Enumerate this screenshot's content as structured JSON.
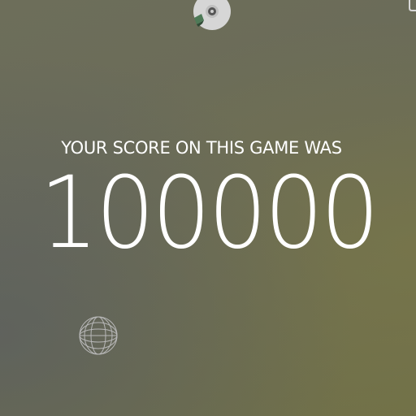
{
  "game": {
    "score_label": "YOUR SCORE ON THIS GAME WAS",
    "score_value": "100000"
  },
  "icons": {
    "top": "disc-icon",
    "corner": "menu-corner-icon",
    "bottom": "wireframe-sphere-icon"
  },
  "colors": {
    "text": "#ffffff",
    "disc": "#d8d8d8",
    "disc_accent": "#4e7a57"
  }
}
